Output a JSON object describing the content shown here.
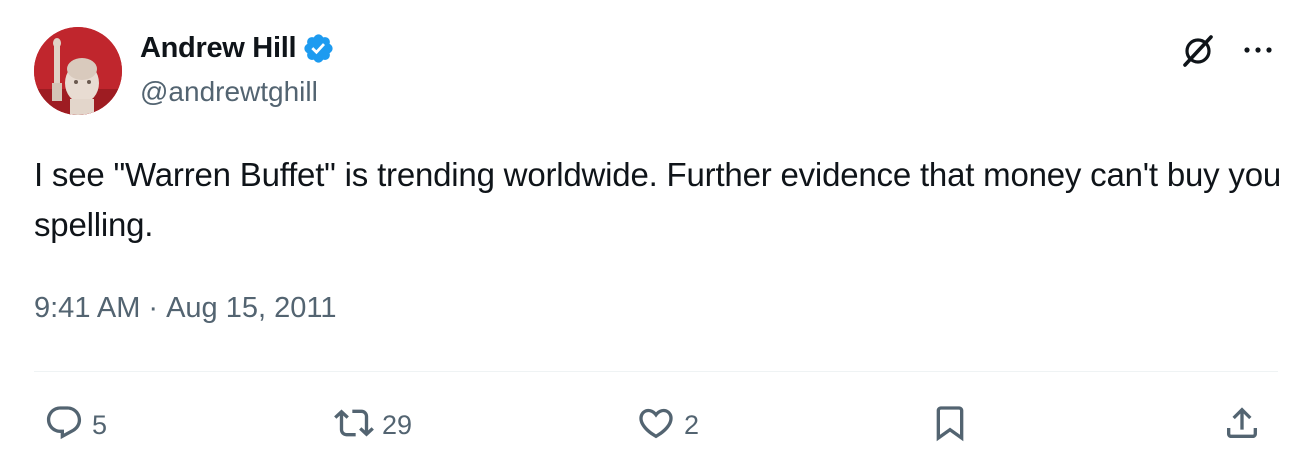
{
  "author": {
    "display_name": "Andrew Hill",
    "handle": "@andrewtghill",
    "verified": true
  },
  "tweet": {
    "text": "I see \"Warren Buffet\" is trending worldwide. Further evidence that money can't buy you spelling.",
    "time": "9:41 AM",
    "separator": "·",
    "date": "Aug 15, 2011"
  },
  "actions": {
    "replies": "5",
    "reposts": "29",
    "likes": "2"
  },
  "colors": {
    "text": "#0f1419",
    "secondary": "#536471",
    "verified": "#1d9bf0",
    "avatar_bg": "#c0262d"
  },
  "icons": [
    "verified-badge-icon",
    "grok-icon",
    "more-icon",
    "reply-icon",
    "retweet-icon",
    "like-icon",
    "bookmark-icon",
    "share-icon"
  ]
}
